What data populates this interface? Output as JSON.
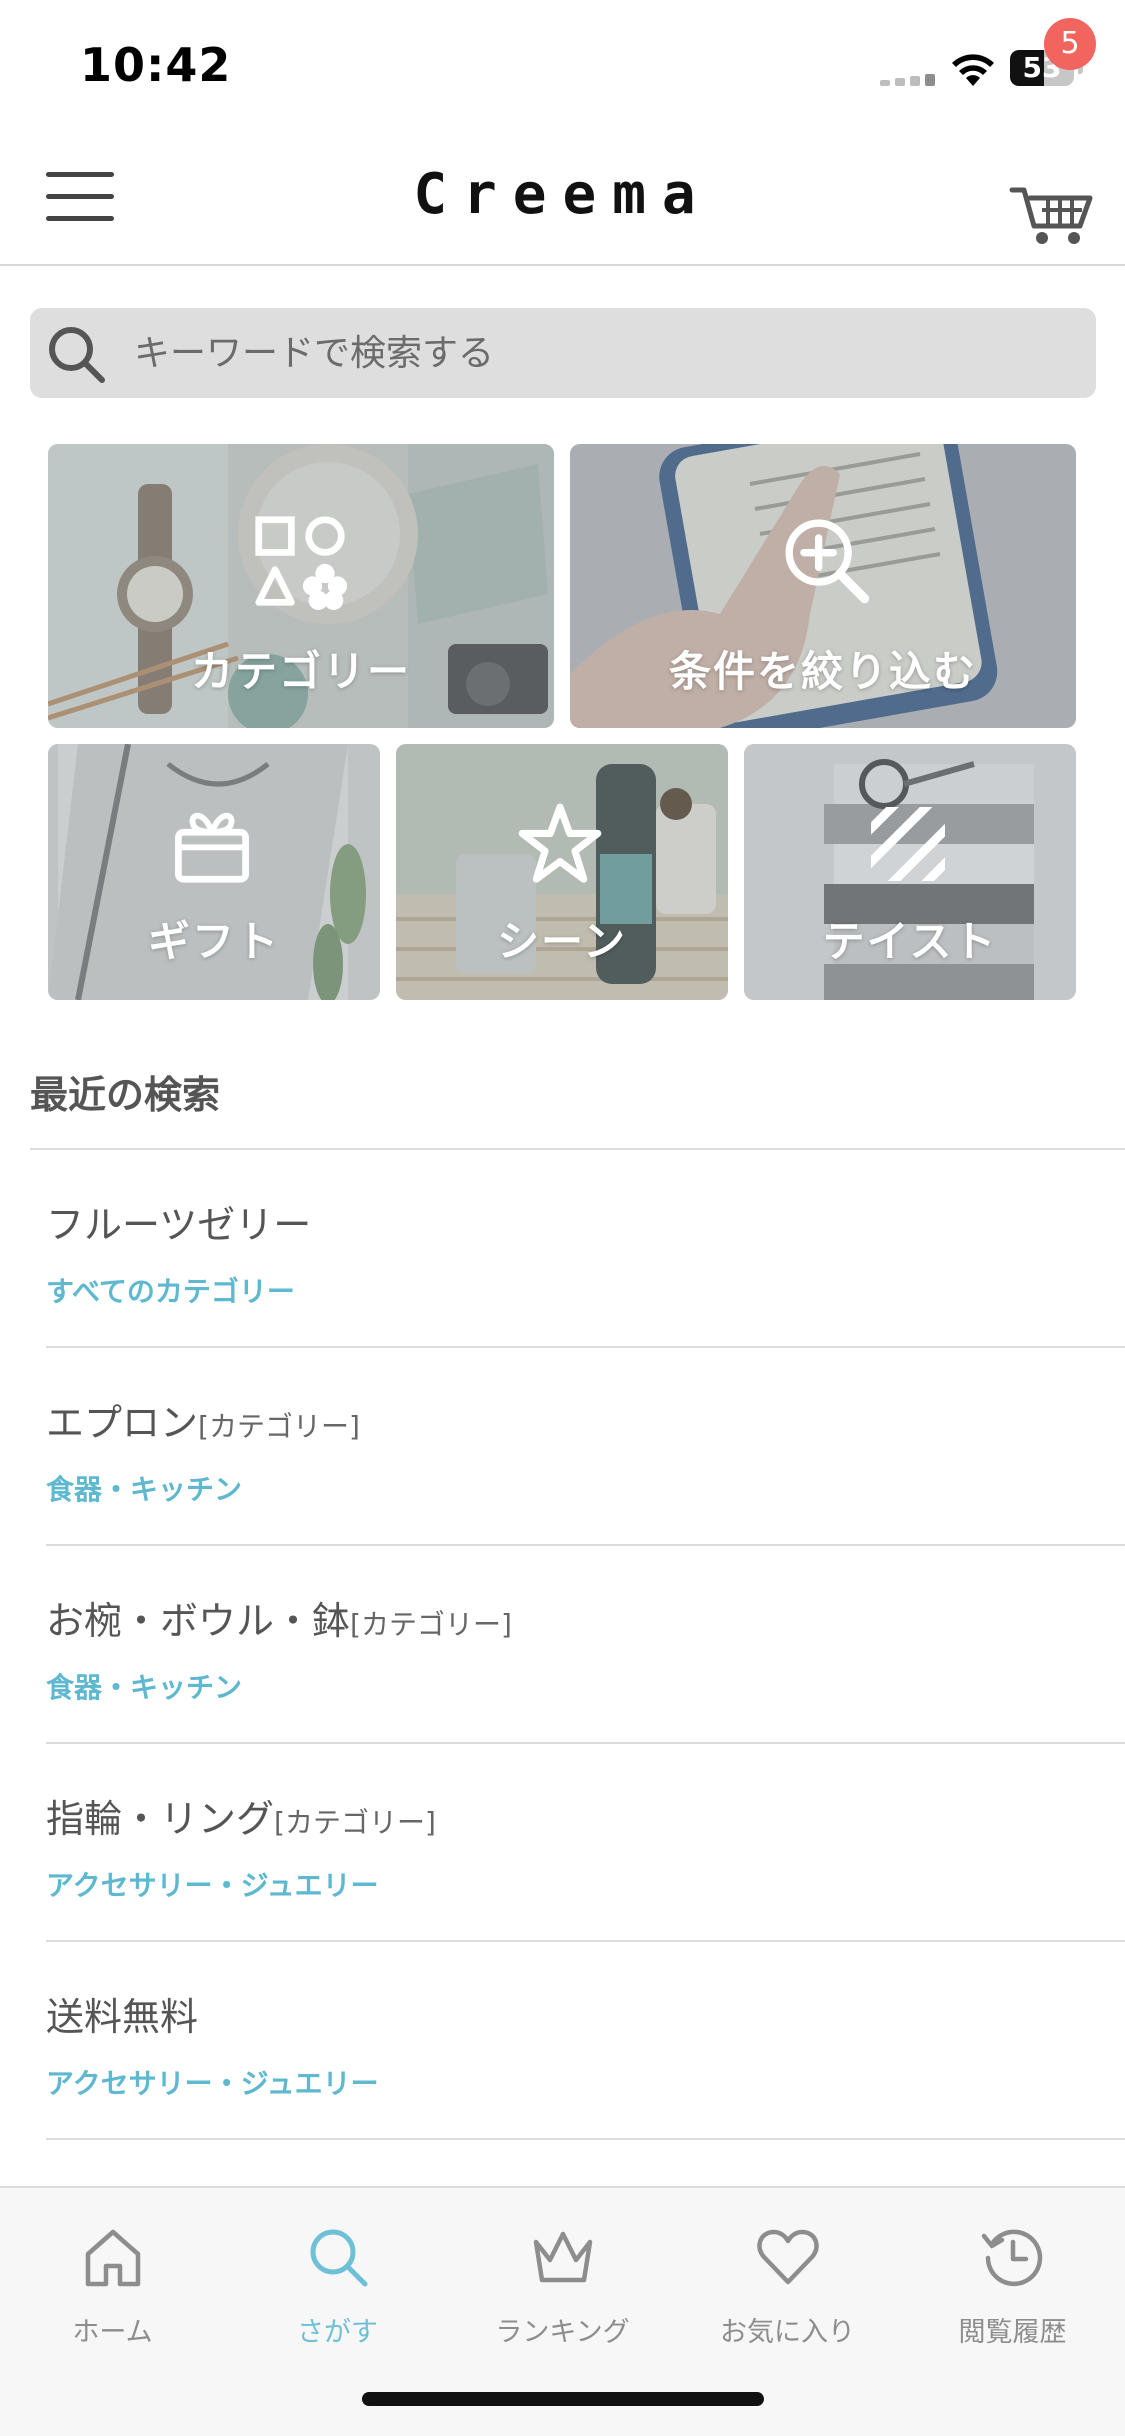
{
  "status_bar": {
    "time": "10:42",
    "battery": "53",
    "battery_level": 0.53
  },
  "header": {
    "logo": "Creema",
    "cart_badge": "5"
  },
  "search": {
    "placeholder": "キーワードで検索する"
  },
  "tiles": {
    "category": {
      "label": "カテゴリー",
      "icon": "shapes-icon"
    },
    "filter": {
      "label": "条件を絞り込む",
      "icon": "zoom-in-icon"
    },
    "gift": {
      "label": "ギフト",
      "icon": "gift-box-icon"
    },
    "scene": {
      "label": "シーン",
      "icon": "star-icon"
    },
    "taste": {
      "label": "テイスト",
      "icon": "stripes-icon"
    }
  },
  "recent": {
    "heading": "最近の検索",
    "items": [
      {
        "term": "フルーツゼリー",
        "tag": "",
        "sub": "すべてのカテゴリー"
      },
      {
        "term": "エプロン",
        "tag": "[カテゴリー]",
        "sub": "食器・キッチン"
      },
      {
        "term": "お椀・ボウル・鉢",
        "tag": "[カテゴリー]",
        "sub": "食器・キッチン"
      },
      {
        "term": "指輪・リング",
        "tag": "[カテゴリー]",
        "sub": "アクセサリー・ジュエリー"
      },
      {
        "term": "送料無料",
        "tag": "",
        "sub": "アクセサリー・ジュエリー"
      }
    ]
  },
  "tab_bar": {
    "tabs": [
      {
        "label": "ホーム",
        "icon": "home-icon"
      },
      {
        "label": "さがす",
        "icon": "search-icon"
      },
      {
        "label": "ランキング",
        "icon": "crown-icon"
      },
      {
        "label": "お気に入り",
        "icon": "heart-icon"
      },
      {
        "label": "閲覧履歴",
        "icon": "history-icon"
      }
    ],
    "active": "さがす"
  },
  "colors": {
    "accent": "#5eb8cf",
    "badge": "#f2645e",
    "text": "#555555"
  }
}
